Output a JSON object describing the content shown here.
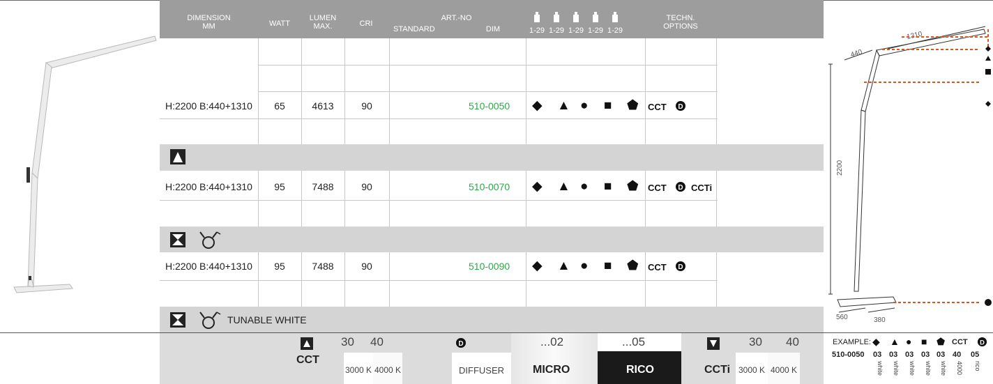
{
  "header": {
    "dimension": "DIMENSION",
    "dimension_unit": "MM",
    "watt": "WATT",
    "lumen": "LUMEN",
    "lumen_sub": "MAX.",
    "cri": "CRI",
    "artno": "ART.-NO",
    "standard": "STANDARD",
    "dim": "DIM",
    "range": "1-29",
    "techn": "TECHN.",
    "options": "OPTIONS"
  },
  "rows": [
    {
      "dimension": "H:2200 B:440+1310",
      "watt": "65",
      "lumen": "4613",
      "cri": "90",
      "artno": "510-0050",
      "tech1": "CCT",
      "tech3": ""
    },
    {
      "dimension": "H:2200 B:440+1310",
      "watt": "95",
      "lumen": "7488",
      "cri": "90",
      "artno": "510-0070",
      "tech1": "CCT",
      "tech3": "CCTi"
    },
    {
      "dimension": "H:2200 B:440+1310",
      "watt": "95",
      "lumen": "7488",
      "cri": "90",
      "artno": "510-0090",
      "tech1": "CCT",
      "tech3": ""
    }
  ],
  "shape_symbols": [
    "◆",
    "▲",
    "●",
    "■",
    "⬟"
  ],
  "dim_symbol": "D",
  "bands": {
    "tunable": "TUNABLE WHITE"
  },
  "footer": {
    "cct_val1": "30",
    "cct_val2": "40",
    "cct_label": "CCT",
    "cct_k1": "3000 K",
    "cct_k2": "4000 K",
    "diffuser": "DIFFUSER",
    "d02": "...02",
    "d05": "...05",
    "micro": "MICRO",
    "rico": "RICO",
    "ccti_val1": "30",
    "ccti_val2": "40",
    "ccti_label": "CCTi",
    "ccti_k1": "3000 K",
    "ccti_k2": "4000 K"
  },
  "example": {
    "label": "EXAMPLE:",
    "cct": "CCT",
    "code": "510-0050",
    "codes": [
      "03",
      "03",
      "03",
      "03",
      "03",
      "40",
      "05"
    ],
    "names": [
      "white",
      "white",
      "white",
      "white",
      "white",
      "4000",
      "rico"
    ]
  },
  "drawing": {
    "d1310": "1310",
    "d440": "440",
    "d2200": "2200",
    "d560": "560",
    "d380": "380"
  },
  "colors": {
    "header_bg": "#9d9d9d",
    "band_bg": "#d4d4d4",
    "artno": "#2ea84a",
    "dash": "#d9541e"
  }
}
